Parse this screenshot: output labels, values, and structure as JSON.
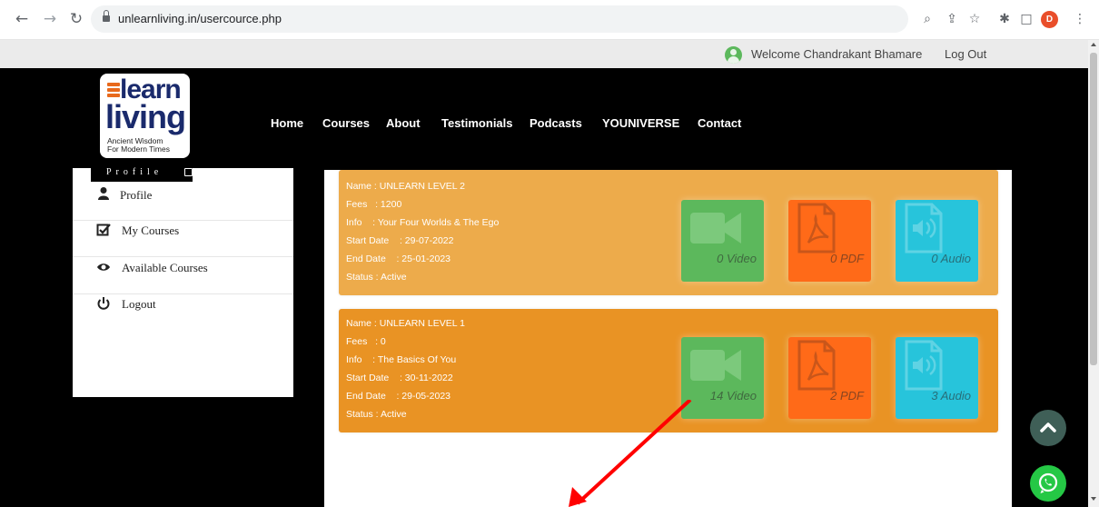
{
  "browser": {
    "url": "unlearnliving.in/usercource.php",
    "profile_initial": "D",
    "icons": [
      "back-icon",
      "forward-icon",
      "reload-icon",
      "lock-icon",
      "zoom-icon",
      "share-icon",
      "star-icon",
      "extensions-icon",
      "sidepanel-icon",
      "menu-icon"
    ]
  },
  "topbar": {
    "welcome": "Welcome Chandrakant Bhamare",
    "logout": "Log Out"
  },
  "logo": {
    "word1": "learn",
    "word2": "living",
    "tagline_line1": "Ancient Wisdom",
    "tagline_line2": "For Modern Times"
  },
  "nav": {
    "items": [
      "Home",
      "Courses",
      "About",
      "Testimonials",
      "Podcasts",
      "YOUNIVERSE",
      "Contact"
    ]
  },
  "sidebar": {
    "header": "Profile",
    "items": [
      {
        "label": "Profile",
        "icon": "user-icon"
      },
      {
        "label": "My   Courses",
        "icon": "checkbox-icon"
      },
      {
        "label": "Available   Courses",
        "icon": "eye-icon"
      },
      {
        "label": "Logout",
        "icon": "power-icon"
      }
    ]
  },
  "courses": [
    {
      "name": "Name : UNLEARN LEVEL 2",
      "fees": "Fees   : 1200",
      "info": "Info    : Your Four Worlds & The Ego",
      "start": "Start Date    : 29-07-2022",
      "end": "End Date    : 25-01-2023",
      "status": "Status : Active",
      "video": "0 Video",
      "pdf": "0 PDF",
      "audio": "0 Audio"
    },
    {
      "name": "Name : UNLEARN LEVEL 1",
      "fees": "Fees   : 0",
      "info": "Info    : The Basics Of You",
      "start": "Start Date    : 30-11-2022",
      "end": "End Date    : 29-05-2023",
      "status": "Status : Active",
      "video": "14 Video",
      "pdf": "2 PDF",
      "audio": "3 Audio"
    }
  ],
  "colors": {
    "card1": "#edab4b",
    "card2": "#e99324",
    "video": "#5cb85c",
    "pdf": "#ff6a18",
    "audio": "#27c4db",
    "annotation_arrow": "#ff0000"
  }
}
